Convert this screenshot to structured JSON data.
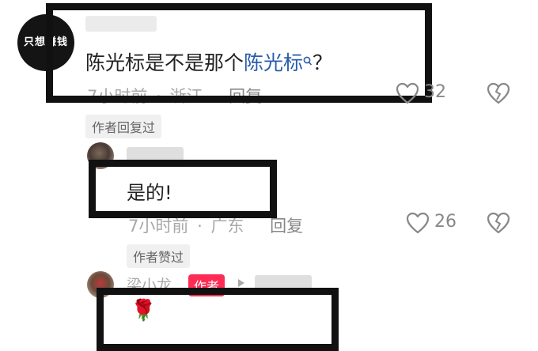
{
  "comment1": {
    "avatar_text": "只想赚钱",
    "text_plain": "陈光标是不是那个",
    "link_text": "陈光标",
    "text_tail": "？",
    "time": "7小时前",
    "location": "浙江",
    "reply_label": "回复",
    "like_count": "32",
    "author_tag": "作者回复过",
    "accent_color": "#2a5caa"
  },
  "comment2": {
    "text": "是的!",
    "time": "7小时前",
    "location": "广东",
    "reply_label": "回复",
    "like_count": "26",
    "author_tag": "作者赞过"
  },
  "comment3": {
    "username": "梁小龙",
    "author_badge": "作者",
    "emoji": "🌹",
    "badge_color": "#fe2c55"
  }
}
